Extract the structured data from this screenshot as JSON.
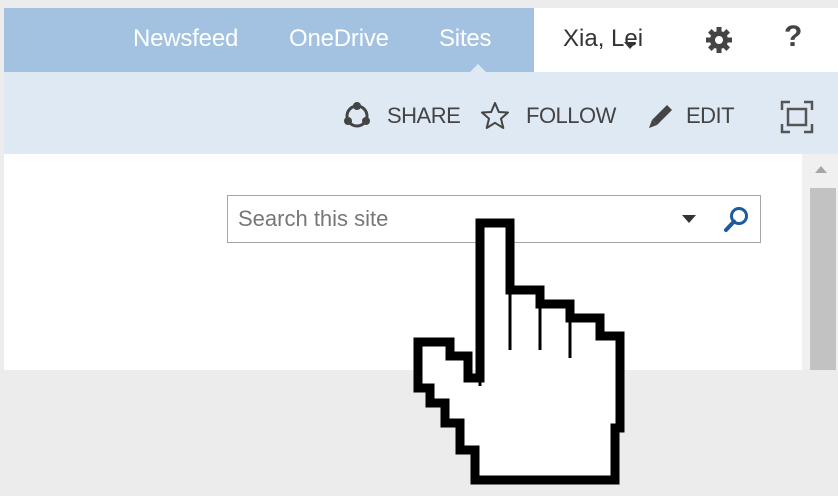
{
  "suite_bar": {
    "nav": {
      "newsfeed": "Newsfeed",
      "onedrive": "OneDrive",
      "sites": "Sites"
    },
    "user_name": "Xia, Lei",
    "settings_icon": "gear-icon",
    "help_label": "?"
  },
  "action_bar": {
    "share_label": "SHARE",
    "follow_label": "FOLLOW",
    "edit_label": "EDIT",
    "focus_icon": "focus-on-content-icon"
  },
  "search": {
    "placeholder": "Search this site",
    "value": ""
  },
  "cursor": {
    "type": "hand-pointer"
  },
  "colors": {
    "suite_bar_bg": "#a3c2e1",
    "action_bar_bg": "#dee9f4",
    "link_text": "#ffffff",
    "body_text": "#444444"
  }
}
